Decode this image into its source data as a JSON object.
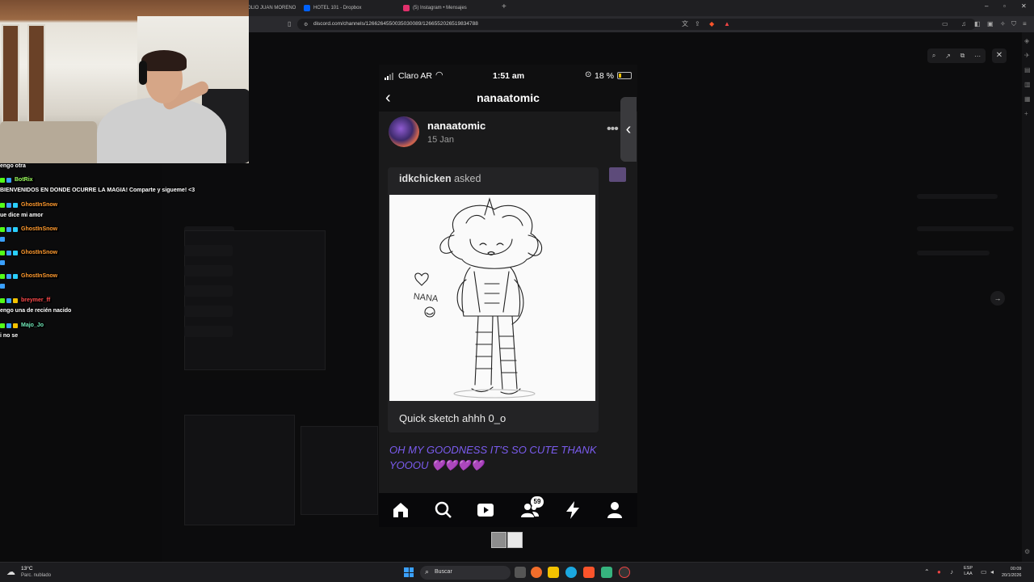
{
  "browser": {
    "tabs": [
      {
        "label": "OLIO JUAN MORENO",
        "color": "#5865f2"
      },
      {
        "label": "HOTEL 101 - Dropbox",
        "color": "#0061fe"
      },
      {
        "label": "(5) Instagram • Mensajes",
        "color": "#e1306c"
      }
    ],
    "new_tab": "+",
    "url": "discord.com/channels/1266264550035030089/1266552026519834788"
  },
  "chat": [
    {
      "user": "",
      "message": "engo otra",
      "color": "#ffffff"
    },
    {
      "user": "BotRix",
      "message": "BIENVENIDOS EN DONDE OCURRE LA MAGIA! Comparte y sigueme! <3",
      "color": "#9cff5e"
    },
    {
      "user": "GhostInSnow",
      "message": "ue dice mi amor",
      "color": "#ff9a2e"
    },
    {
      "user": "GhostInSnow",
      "message": "",
      "color": "#ff9a2e"
    },
    {
      "user": "GhostInSnow",
      "message": "",
      "color": "#ff9a2e"
    },
    {
      "user": "GhostInSnow",
      "message": "",
      "color": "#ff9a2e"
    },
    {
      "user": "breymer_ff",
      "message": "engo una de recién nacido",
      "color": "#ff4a4a"
    },
    {
      "user": "Majo_Jo",
      "message": "i no se",
      "color": "#6fe8b7"
    }
  ],
  "phone": {
    "status": {
      "carrier": "Claro AR",
      "time": "1:51 am",
      "battery": "18 %"
    },
    "nav_title": "nanaatomic",
    "post": {
      "username": "nanaatomic",
      "date": "15 Jan",
      "asker": "idkchicken",
      "asked_word": "asked",
      "question_caption": "Quick sketch ahhh 0_o",
      "reply": "OH MY GOODNESS IT'S SO CUTE THANK YOOOU",
      "reply_hearts": "💜💜💜💜",
      "drawing_text": "NANA"
    },
    "tabbar": {
      "icons": [
        "home-icon",
        "search-icon",
        "video-icon",
        "people-icon",
        "bolt-icon",
        "profile-icon"
      ],
      "people_badge": "59"
    }
  },
  "taskbar": {
    "weather_temp": "13°C",
    "weather_desc": "Parc. nublado",
    "search_label": "Buscar",
    "lang_top": "ESP",
    "lang_bottom": "LAA",
    "time": "00:09",
    "date": "20/1/2026"
  }
}
